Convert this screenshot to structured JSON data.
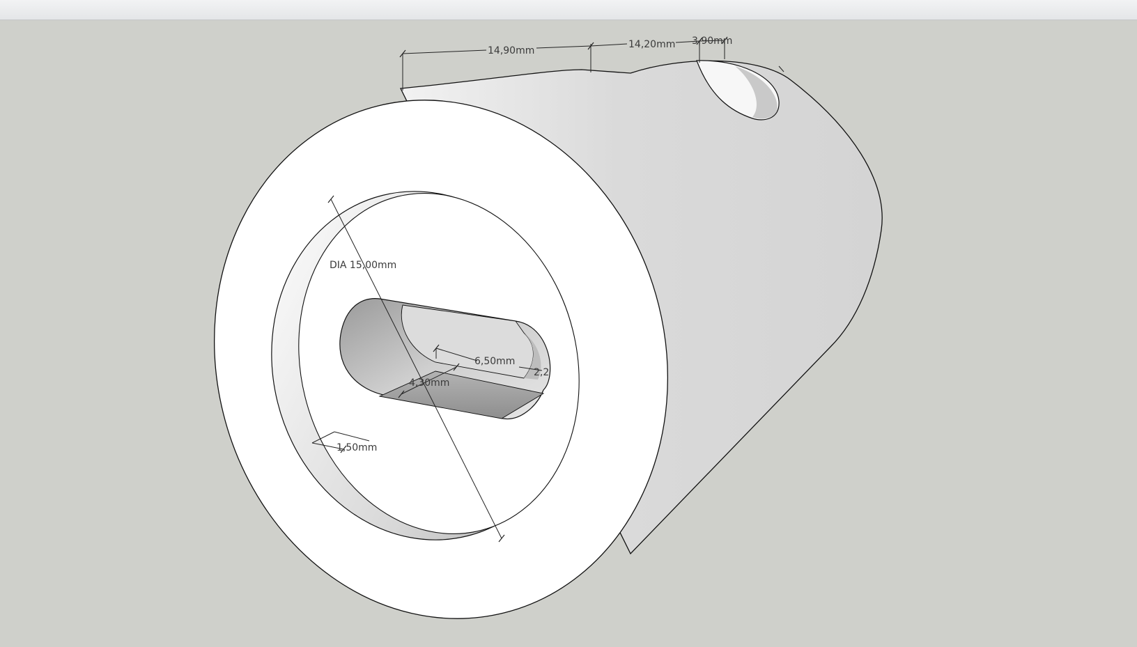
{
  "viewport": {
    "background": "#cfd0cb",
    "titlebar_color": "#eceef0"
  },
  "model": {
    "part": "cylinder-with-bore-and-slot",
    "dimensions": {
      "length_1": "14,90mm",
      "length_2": "14,20mm",
      "length_3": "3,90mm",
      "bore_diameter": "DIA 15,00mm",
      "slot_length": "6,50mm",
      "slot_width": "4,30mm",
      "slot_end": "2,2",
      "wall_thickness": "1,50mm"
    }
  }
}
